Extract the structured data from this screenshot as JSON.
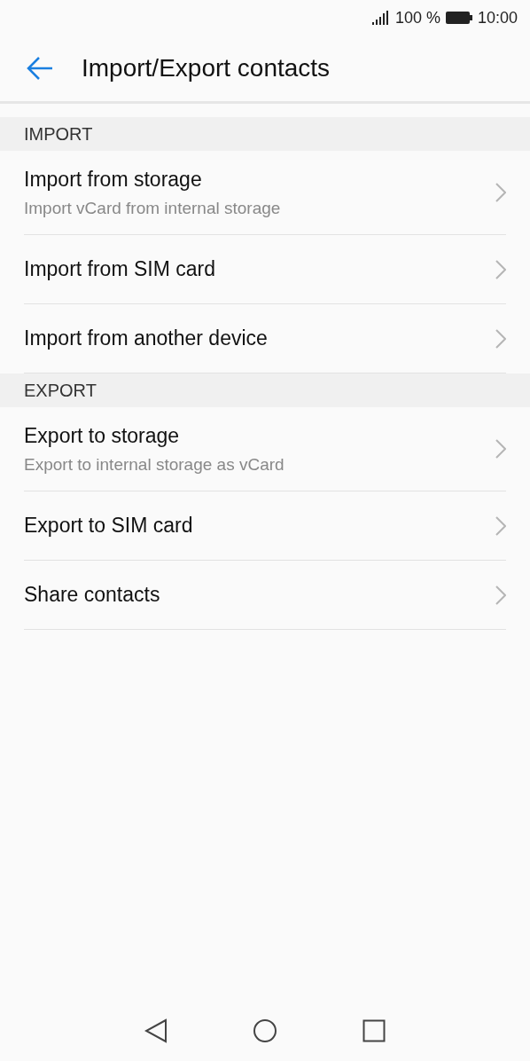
{
  "status_bar": {
    "battery": "100 %",
    "time": "10:00"
  },
  "header": {
    "title": "Import/Export contacts"
  },
  "sections": [
    {
      "title": "IMPORT",
      "items": [
        {
          "title": "Import from storage",
          "subtitle": "Import vCard from internal storage"
        },
        {
          "title": "Import from SIM card"
        },
        {
          "title": "Import from another device"
        }
      ]
    },
    {
      "title": "EXPORT",
      "items": [
        {
          "title": "Export to storage",
          "subtitle": "Export to internal storage as vCard"
        },
        {
          "title": "Export to SIM card"
        },
        {
          "title": "Share contacts"
        }
      ]
    }
  ]
}
